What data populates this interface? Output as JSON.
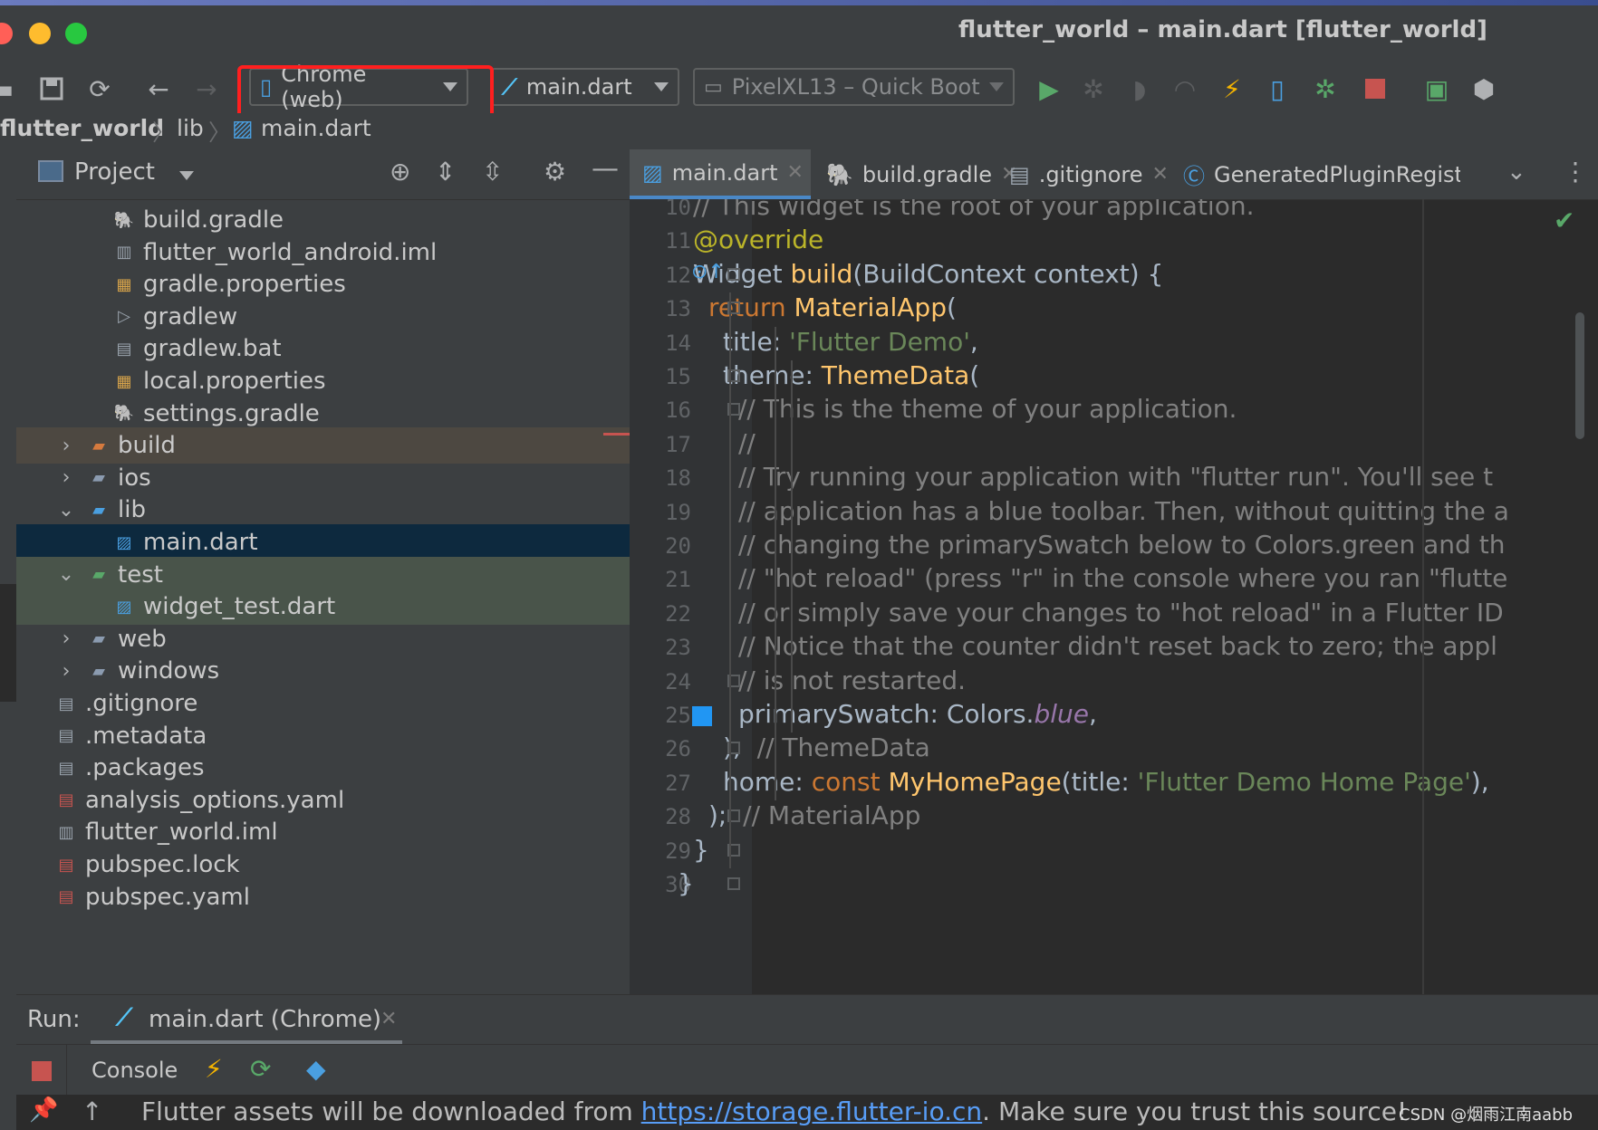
{
  "window": {
    "title": "flutter_world – main.dart [flutter_world]"
  },
  "toolbar": {
    "device_selector": "Chrome (web)",
    "run_config": "main.dart",
    "emulator": "PixelXL13 – Quick Boot"
  },
  "breadcrumb": {
    "project": "flutter_world",
    "folder": "lib",
    "file": "main.dart"
  },
  "project_panel": {
    "title": "Project",
    "items": [
      {
        "name": "build.gradle",
        "indent": 2,
        "kind": "gradle"
      },
      {
        "name": "flutter_world_android.iml",
        "indent": 2,
        "kind": "iml"
      },
      {
        "name": "gradle.properties",
        "indent": 2,
        "kind": "props"
      },
      {
        "name": "gradlew",
        "indent": 2,
        "kind": "exec"
      },
      {
        "name": "gradlew.bat",
        "indent": 2,
        "kind": "file"
      },
      {
        "name": "local.properties",
        "indent": 2,
        "kind": "props"
      },
      {
        "name": "settings.gradle",
        "indent": 2,
        "kind": "gradle"
      },
      {
        "name": "build",
        "indent": 1,
        "kind": "folder-build",
        "chevron": "right"
      },
      {
        "name": "ios",
        "indent": 1,
        "kind": "folder",
        "chevron": "right"
      },
      {
        "name": "lib",
        "indent": 1,
        "kind": "folder-open",
        "chevron": "down"
      },
      {
        "name": "main.dart",
        "indent": 2,
        "kind": "dart"
      },
      {
        "name": "test",
        "indent": 1,
        "kind": "folder-test",
        "chevron": "down"
      },
      {
        "name": "widget_test.dart",
        "indent": 2,
        "kind": "dart"
      },
      {
        "name": "web",
        "indent": 1,
        "kind": "folder",
        "chevron": "right"
      },
      {
        "name": "windows",
        "indent": 1,
        "kind": "folder",
        "chevron": "right"
      },
      {
        "name": ".gitignore",
        "indent": 1,
        "kind": "file"
      },
      {
        "name": ".metadata",
        "indent": 1,
        "kind": "file"
      },
      {
        "name": ".packages",
        "indent": 1,
        "kind": "file"
      },
      {
        "name": "analysis_options.yaml",
        "indent": 1,
        "kind": "yaml"
      },
      {
        "name": "flutter_world.iml",
        "indent": 1,
        "kind": "iml"
      },
      {
        "name": "pubspec.lock",
        "indent": 1,
        "kind": "yaml"
      },
      {
        "name": "pubspec.yaml",
        "indent": 1,
        "kind": "yaml"
      }
    ]
  },
  "editor": {
    "tabs": [
      {
        "label": "main.dart",
        "active": true
      },
      {
        "label": "build.gradle",
        "active": false
      },
      {
        "label": ".gitignore",
        "active": false
      },
      {
        "label": "GeneratedPluginRegistra",
        "active": false
      }
    ],
    "lines": [
      {
        "n": "10",
        "segs": [
          [
            "cm",
            "// This widget is the root of your application."
          ]
        ],
        "indent": 0
      },
      {
        "n": "11",
        "segs": [
          [
            "ann",
            "@override"
          ]
        ],
        "indent": 0
      },
      {
        "n": "12",
        "segs": [
          [
            "plain",
            "Widget "
          ],
          [
            "fn",
            "build"
          ],
          [
            "plain",
            "(BuildContext context) {"
          ]
        ],
        "indent": 0
      },
      {
        "n": "13",
        "segs": [
          [
            "kw",
            "return "
          ],
          [
            "fn",
            "MaterialApp"
          ],
          [
            "plain",
            "("
          ]
        ],
        "indent": 1
      },
      {
        "n": "14",
        "segs": [
          [
            "plain",
            "title: "
          ],
          [
            "str",
            "'Flutter Demo'"
          ],
          [
            "plain",
            ","
          ]
        ],
        "indent": 2
      },
      {
        "n": "15",
        "segs": [
          [
            "plain",
            "theme: "
          ],
          [
            "fn",
            "ThemeData"
          ],
          [
            "plain",
            "("
          ]
        ],
        "indent": 2
      },
      {
        "n": "16",
        "segs": [
          [
            "cm",
            "// This is the theme of your application."
          ]
        ],
        "indent": 3
      },
      {
        "n": "17",
        "segs": [
          [
            "cm",
            "//"
          ]
        ],
        "indent": 3
      },
      {
        "n": "18",
        "segs": [
          [
            "cm",
            "// Try running your application with \"flutter run\". You'll see t"
          ]
        ],
        "indent": 3
      },
      {
        "n": "19",
        "segs": [
          [
            "cm",
            "// application has a blue toolbar. Then, without quitting the a"
          ]
        ],
        "indent": 3
      },
      {
        "n": "20",
        "segs": [
          [
            "cm",
            "// changing the primarySwatch below to Colors.green and th"
          ]
        ],
        "indent": 3
      },
      {
        "n": "21",
        "segs": [
          [
            "cm",
            "// \"hot reload\" (press \"r\" in the console where you ran \"flutte"
          ]
        ],
        "indent": 3
      },
      {
        "n": "22",
        "segs": [
          [
            "cm",
            "// or simply save your changes to \"hot reload\" in a Flutter ID"
          ]
        ],
        "indent": 3
      },
      {
        "n": "23",
        "segs": [
          [
            "cm",
            "// Notice that the counter didn't reset back to zero; the appl"
          ]
        ],
        "indent": 3
      },
      {
        "n": "24",
        "segs": [
          [
            "cm",
            "// is not restarted."
          ]
        ],
        "indent": 3
      },
      {
        "n": "25",
        "segs": [
          [
            "plain",
            "primarySwatch: Colors."
          ],
          [
            "it",
            "blue"
          ],
          [
            "plain",
            ","
          ]
        ],
        "indent": 3
      },
      {
        "n": "26",
        "segs": [
          [
            "plain",
            "), "
          ],
          [
            "cm",
            " // ThemeData"
          ]
        ],
        "indent": 2
      },
      {
        "n": "27",
        "segs": [
          [
            "plain",
            "home: "
          ],
          [
            "kw",
            "const "
          ],
          [
            "fn",
            "MyHomePage"
          ],
          [
            "plain",
            "(title: "
          ],
          [
            "str",
            "'Flutter Demo Home Page'"
          ],
          [
            "plain",
            "),"
          ]
        ],
        "indent": 2
      },
      {
        "n": "28",
        "segs": [
          [
            "plain",
            "); "
          ],
          [
            "cm",
            " // MaterialApp"
          ]
        ],
        "indent": 1
      },
      {
        "n": "29",
        "segs": [
          [
            "plain",
            "}"
          ]
        ],
        "indent": 0
      },
      {
        "n": "30",
        "segs": [
          [
            "plain",
            "}"
          ]
        ],
        "indent": -1
      }
    ]
  },
  "run_panel": {
    "label": "Run:",
    "tab": "main.dart (Chrome)",
    "console_label": "Console",
    "output_prefix": "Flutter assets will be downloaded from ",
    "output_link": "https://storage.flutter-io.cn",
    "output_suffix": ". Make sure you trust this source!"
  },
  "watermark": "CSDN @烟雨江南aabb",
  "colors": {
    "accent": "#4a88c7",
    "highlight_box": "#ff1f1f",
    "selected_row": "#0d293e",
    "test_row": "#49544a",
    "build_row": "#4d4841"
  }
}
